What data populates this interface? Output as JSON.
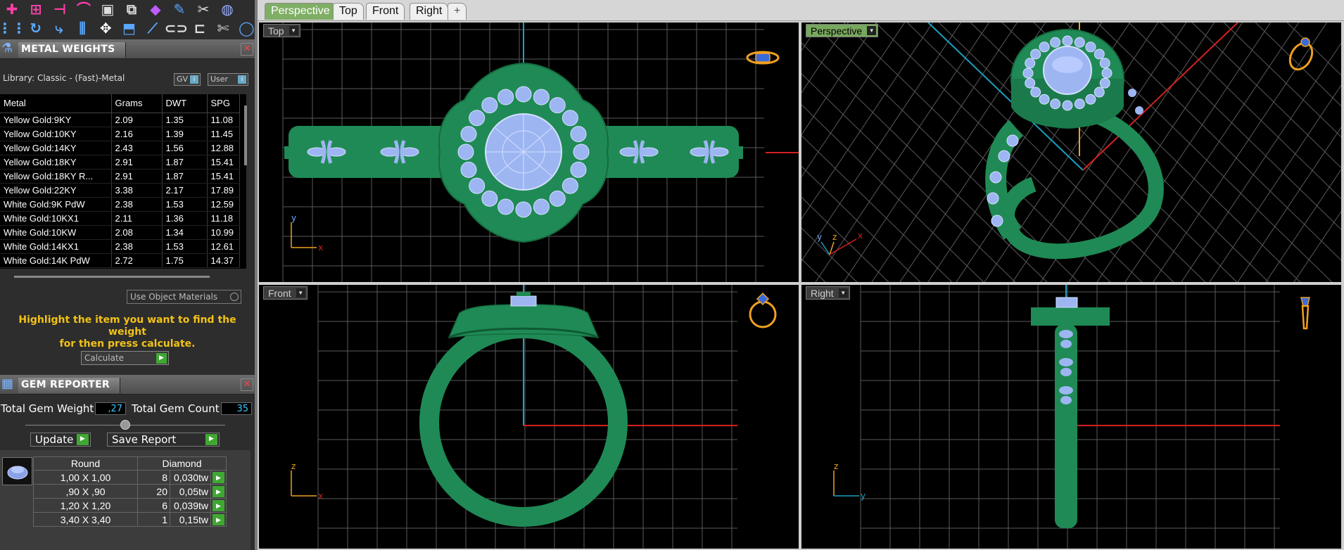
{
  "toolbar": {
    "row1_icons": [
      "snap-point-icon",
      "snap-add-icon",
      "snap-line-icon",
      "snap-curve-icon",
      "select-box-icon",
      "layer-icon",
      "render-icon",
      "pen-icon",
      "eraser-icon",
      "sphere-icon"
    ],
    "row2_icons": [
      "grid-icon",
      "arc-icon",
      "spiral-icon",
      "align-icon",
      "move-icon",
      "scale-icon",
      "sweep-icon",
      "group-icon",
      "ungroup-icon",
      "cut-icon",
      "circle-icon"
    ]
  },
  "metal_weights": {
    "title": "METAL WEIGHTS",
    "library": "Library: Classic - (Fast)-Metal",
    "gv_label": "GV",
    "user_label": "User",
    "columns": [
      "Metal",
      "Grams",
      "DWT",
      "SPG"
    ],
    "rows": [
      [
        "Yellow Gold:9KY",
        "2.09",
        "1.35",
        "11.08"
      ],
      [
        "Yellow Gold:10KY",
        "2.16",
        "1.39",
        "11.45"
      ],
      [
        "Yellow Gold:14KY",
        "2.43",
        "1.56",
        "12.88"
      ],
      [
        "Yellow Gold:18KY",
        "2.91",
        "1.87",
        "15.41"
      ],
      [
        "Yellow Gold:18KY R...",
        "2.91",
        "1.87",
        "15.41"
      ],
      [
        "Yellow Gold:22KY",
        "3.38",
        "2.17",
        "17.89"
      ],
      [
        "White Gold:9K PdW",
        "2.38",
        "1.53",
        "12.59"
      ],
      [
        "White Gold:10KX1",
        "2.11",
        "1.36",
        "11.18"
      ],
      [
        "White Gold:10KW",
        "2.08",
        "1.34",
        "10.99"
      ],
      [
        "White Gold:14KX1",
        "2.38",
        "1.53",
        "12.61"
      ],
      [
        "White Gold:14K PdW",
        "2.72",
        "1.75",
        "14.37"
      ]
    ],
    "use_object_materials": "Use Object Materials",
    "instruction_line1": "Highlight the item you want to find the weight",
    "instruction_line2": "for then press calculate.",
    "calculate": "Calculate"
  },
  "gem_reporter": {
    "title": "GEM REPORTER",
    "total_weight_label": "Total Gem Weight",
    "total_weight": ",27",
    "total_count_label": "Total Gem Count",
    "total_count": "35",
    "update": "Update",
    "save_report": "Save Report",
    "shape": "Round",
    "material": "Diamond",
    "rows": [
      [
        "1,00 X 1,00",
        "8",
        "0,030tw"
      ],
      [
        ",90 X ,90",
        "20",
        "0,05tw"
      ],
      [
        "1,20 X 1,20",
        "6",
        "0,039tw"
      ],
      [
        "3,40 X 3,40",
        "1",
        "0,15tw"
      ]
    ]
  },
  "tabs": [
    "Perspective",
    "Top",
    "Front",
    "Right",
    "+"
  ],
  "viewports": {
    "top": "Top",
    "perspective": "Perspective",
    "front": "Front",
    "right": "Right"
  },
  "axes": {
    "x": "x",
    "y": "y",
    "z": "z"
  },
  "colors": {
    "model_green": "#1f8a55",
    "gem_blue": "#9db6f2",
    "grid": "#5a5a5a",
    "axis_red": "#d42020",
    "axis_cyan": "#1aa0c0",
    "accent_orange": "#f0a020",
    "instruction_yellow": "#f2c218"
  }
}
